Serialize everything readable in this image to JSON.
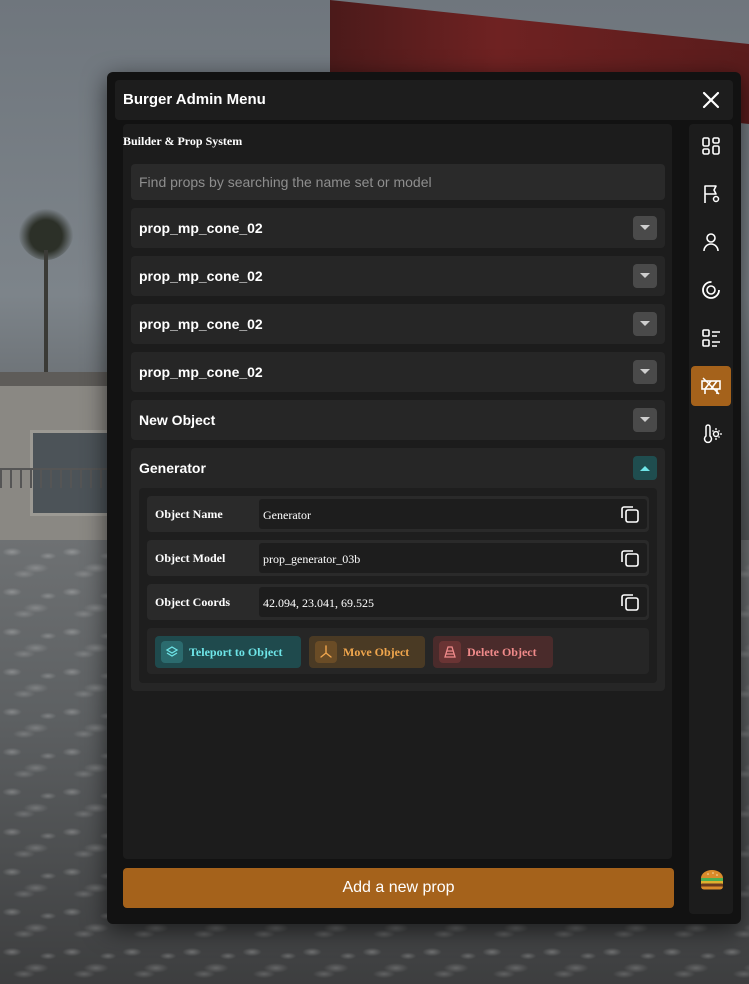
{
  "window": {
    "title": "Burger Admin Menu"
  },
  "section": {
    "title": "Builder & Prop System"
  },
  "search": {
    "placeholder": "Find props by searching the name set or model"
  },
  "props": [
    {
      "label": "prop_mp_cone_02"
    },
    {
      "label": "prop_mp_cone_02"
    },
    {
      "label": "prop_mp_cone_02"
    },
    {
      "label": "prop_mp_cone_02"
    },
    {
      "label": "New Object"
    }
  ],
  "selected": {
    "label": "Generator",
    "fields": [
      {
        "label": "Object Name",
        "value": "Generator"
      },
      {
        "label": "Object Model",
        "value": "prop_generator_03b"
      },
      {
        "label": "Object Coords",
        "value": "42.094, 23.041, 69.525"
      }
    ],
    "actions": {
      "teleport": "Teleport to Object",
      "move": "Move Object",
      "delete": "Delete Object"
    }
  },
  "add_button": {
    "label": "Add a new prop"
  },
  "sidebar": {
    "items": [
      {
        "icon": "dashboard-icon"
      },
      {
        "icon": "flag-marker-icon"
      },
      {
        "icon": "user-icon"
      },
      {
        "icon": "refresh-circle-icon"
      },
      {
        "icon": "list-icon"
      },
      {
        "icon": "road-barrier-icon",
        "active": true
      },
      {
        "icon": "weather-icon"
      }
    ]
  },
  "colors": {
    "accent": "#a5621b",
    "teleport": "#6ee5e8",
    "move": "#f0a64d",
    "delete": "#f08a8a"
  }
}
